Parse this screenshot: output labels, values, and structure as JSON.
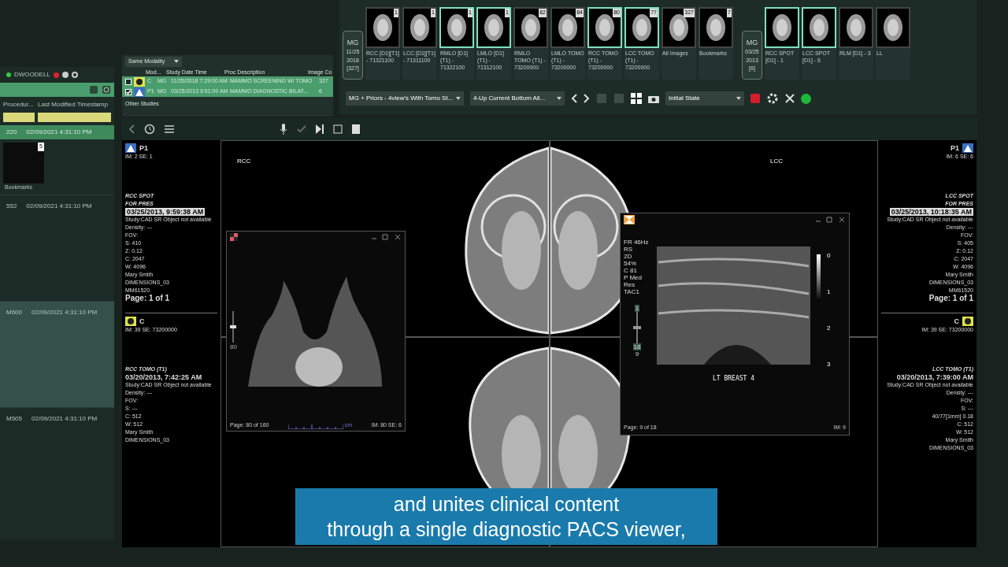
{
  "worklist": {
    "user": "DWOODELL",
    "columns": [
      "Procedur...",
      "Last Modified Timestamp"
    ],
    "highlighted": {
      "id": "220",
      "timestamp": "02/09/2021 4:31:10 PM"
    },
    "thumbnail": {
      "label": "Bookmarks",
      "count": "5"
    },
    "rows": [
      {
        "id": "552",
        "timestamp": "02/09/2021 4:31:10 PM",
        "selected": false
      },
      {
        "id": "M600",
        "timestamp": "02/09/2021 4:31:10 PM",
        "selected": true
      },
      {
        "id": "M505",
        "timestamp": "02/09/2021 4:31:10 PM",
        "selected": false
      }
    ]
  },
  "study_list": {
    "filter": "Same Modality",
    "columns": [
      "Mod...",
      "Study Date Time",
      "Proc Description",
      "Image Co"
    ],
    "rows": [
      {
        "kind": "current",
        "marker": "C",
        "modality": "MG",
        "date": "11/25/2018 7:29:00 AM",
        "description": "MAMMO SCREENING W/ TOMO",
        "count": "327",
        "checked": false
      },
      {
        "kind": "prior",
        "marker": "P1",
        "modality": "MG",
        "date": "03/25/2013 9:51:00 AM",
        "description": "MAMMO DIAGNOSTIC BILAT...",
        "count": "6",
        "checked": true
      }
    ],
    "footer": "Other Studies"
  },
  "thumbnail_strip": [
    {
      "modality": "MG",
      "date": "11/25",
      "year": "2018",
      "count": "[327]",
      "items": [
        {
          "label": "RCC [D1][T1] - 71321100",
          "count": "1",
          "selected": false
        },
        {
          "label": "LCC [D1][T1] - 71311100",
          "count": "1",
          "selected": false
        },
        {
          "label": "RMLO [D1] (T1) - 71322100",
          "count": "1",
          "selected": true
        },
        {
          "label": "LMLO [D1] (T1) - 71312100",
          "count": "1",
          "selected": true
        },
        {
          "label": "RMLO TOMO (T1) - 73200000",
          "count": "82",
          "selected": false
        },
        {
          "label": "LMLO TOMO (T1) - 73200000",
          "count": "84",
          "selected": false
        },
        {
          "label": "RCC TOMO (T1) - 73200000",
          "count": "80",
          "selected": true
        },
        {
          "label": "LCC TOMO (T1) - 73200000",
          "count": "77",
          "selected": true
        },
        {
          "label": "All Images",
          "count": "327",
          "selected": false
        },
        {
          "label": "Bookmarks",
          "count": "7",
          "selected": false
        }
      ]
    },
    {
      "modality": "MG",
      "date": "03/25",
      "year": "2013",
      "count": "[6]",
      "items": [
        {
          "label": "RCC SPOT [D1] - 1",
          "selected": true
        },
        {
          "label": "LCC SPOT [D1] - 6",
          "selected": true
        },
        {
          "label": "RLM [D1] - 3",
          "selected": false
        },
        {
          "label": "LL",
          "selected": false
        }
      ]
    }
  ],
  "toolbar": {
    "hanging_protocol": "MG + Priors - 4view's With Tomo St...",
    "layout": "4-Up Current Bottom All...",
    "state": "Initial State"
  },
  "viewports": [
    {
      "kind": "prior",
      "marker": "P1",
      "image_info": "IM: 2 SE: 1",
      "title": [
        "RCC SPOT",
        "FOR PRES"
      ],
      "date": "03/25/2013, 9:59:38 AM",
      "lines": [
        "Study:CAD SR Object not available",
        "Density: ---",
        "FOV:",
        "S: 410",
        "Z: 0.12",
        "C: 2047",
        "W: 4096",
        "Mary Smith",
        "DIMENSIONS_03",
        "MM61520"
      ],
      "page": "Page: 1 of 1",
      "label": "RCC"
    },
    {
      "kind": "prior",
      "marker": "P1",
      "image_info": "IM: 6 SE: 6",
      "title": [
        "LCC SPOT",
        "FOR PRES"
      ],
      "date": "03/25/2013, 10:18:35 AM",
      "lines": [
        "Study:CAD SR Object not available",
        "Density: ---",
        "FOV:",
        "S: 405",
        "Z: 0.12",
        "C: 2047",
        "W: 4096",
        "Mary Smith",
        "DIMENSIONS_03",
        "MM61520"
      ],
      "page": "Page: 1 of 1",
      "label": "LCC"
    },
    {
      "kind": "current",
      "marker": "C",
      "image_info": "IM: 39 SE: 73200000",
      "title": [
        "RCC TOMO (T1)"
      ],
      "date": "03/20/2013, 7:42:25 AM",
      "lines": [
        "Study:CAD SR Object not available",
        "Density: ---",
        "FOV:",
        "S: ---",
        "C: 512",
        "W: 512",
        "Mary Smith",
        "DIMENSIONS_03"
      ]
    },
    {
      "kind": "current",
      "marker": "C",
      "image_info": "IM: 39 SE: 73200000",
      "title": [
        "LCC TOMO (T1)"
      ],
      "date": "03/20/2013, 7:39:00 AM",
      "lines": [
        "Study:CAD SR Object not available",
        "Density: ---",
        "FOV:",
        "S: ---",
        "40/77[1mm] 0.18",
        "C: 512",
        "W: 512",
        "Mary Smith",
        "DIMENSIONS_03"
      ]
    }
  ],
  "mri_window": {
    "page": "Page: 80 of 160",
    "image_info": "IM: 80 SE: 6",
    "scale_unit": "cm",
    "slice": "80",
    "level": 0.5
  },
  "ultrasound_window": {
    "settings": [
      "FR 46Hz",
      "RS",
      "2D",
      "54%",
      "C 81",
      "P Med",
      "Res",
      "TAC1"
    ],
    "slider": [
      "1",
      "18",
      "9"
    ],
    "level": 0.5,
    "depth": [
      "0",
      "1",
      "2",
      "3"
    ],
    "caption": "LT BREAST 4",
    "page": "Page: 9 of 18",
    "image_info": "IM: 9"
  },
  "subtitle": [
    "and unites clinical content",
    "through a single diagnostic PACS viewer,"
  ]
}
